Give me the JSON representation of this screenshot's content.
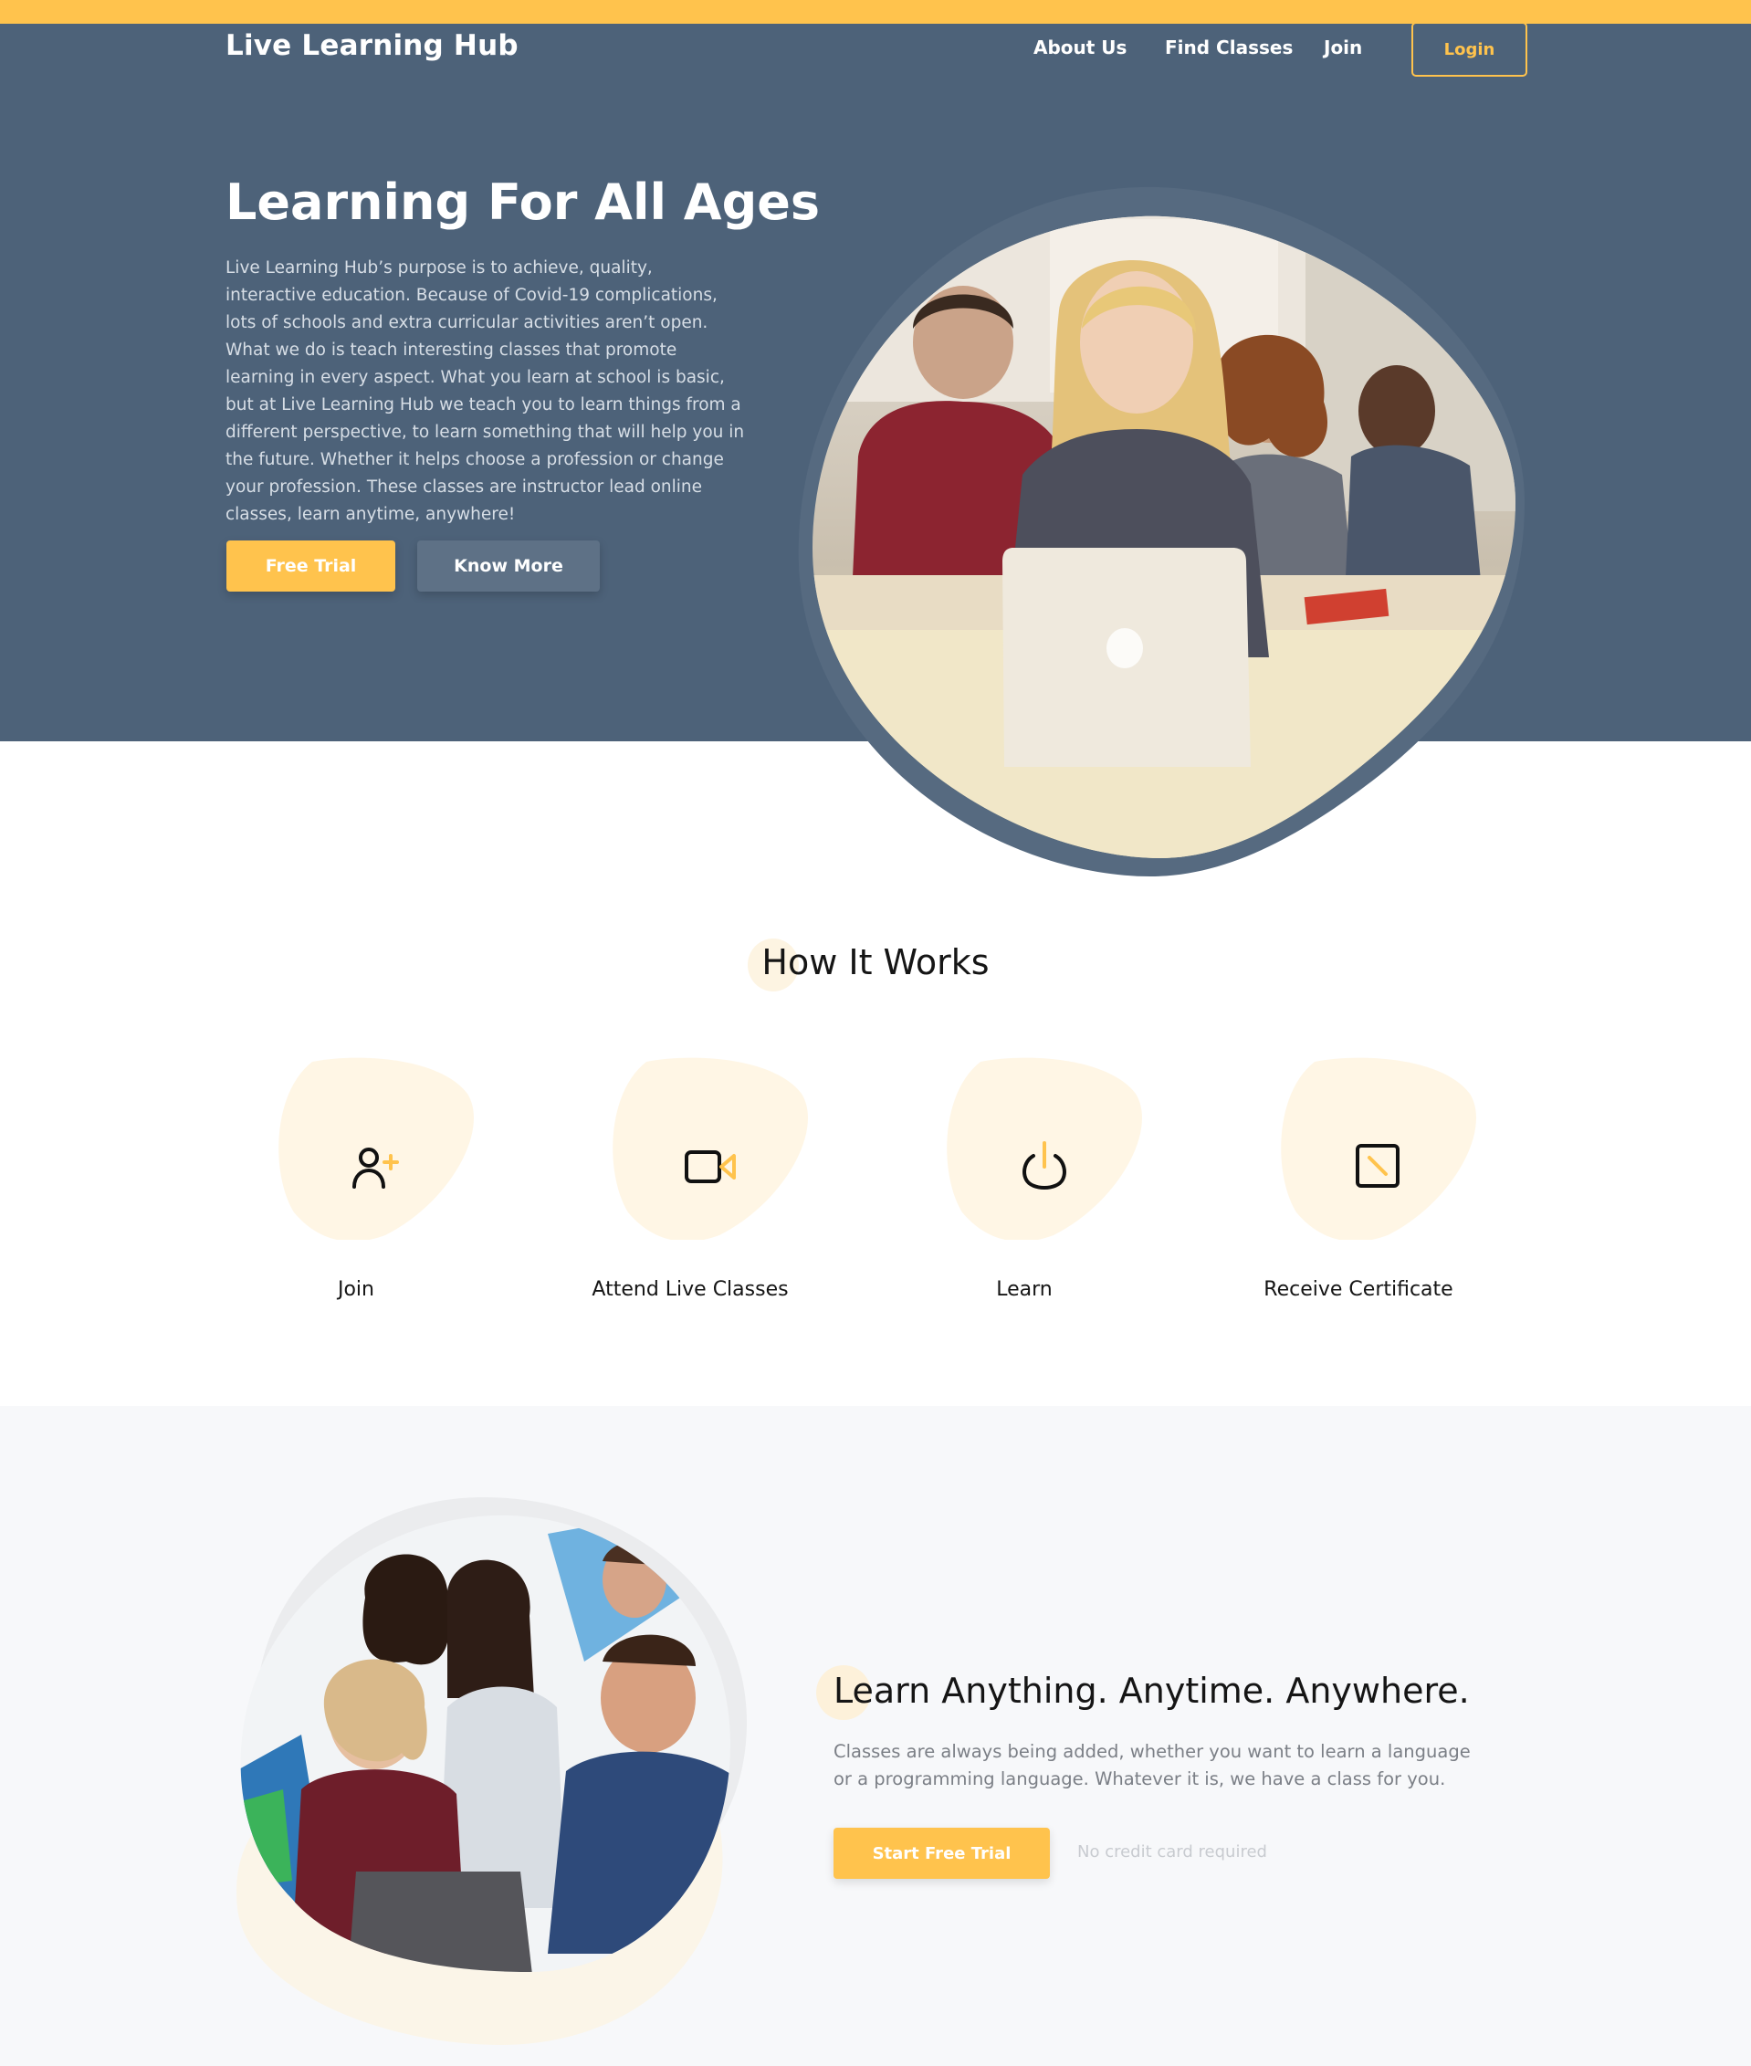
{
  "brand": {
    "name": "Live Learning Hub"
  },
  "nav": {
    "links": [
      "About Us",
      "Find Classes",
      "Join"
    ],
    "login": "Login"
  },
  "hero": {
    "title": "Learning For All Ages",
    "text": "Live Learning Hub’s purpose is to achieve, quality, interactive education. Because of Covid-19 complications, lots of schools and extra curricular activities aren’t open. What we do is teach interesting classes that promote learning in every aspect. What you learn at school is basic, but at Live Learning Hub we teach you to learn things from a different perspective, to learn something that will help you in the future. Whether it helps choose a profession or change your profession. These classes are instructor lead online classes, learn anytime, anywhere!",
    "primary_button": "Free Trial",
    "secondary_button": "Know More",
    "image": "student-with-laptop-photo"
  },
  "how_it_works": {
    "title": "How It Works",
    "steps": [
      {
        "label": "Join",
        "icon": "user-plus-icon"
      },
      {
        "label": "Attend Live Classes",
        "icon": "video-camera-icon"
      },
      {
        "label": "Learn",
        "icon": "power-icon"
      },
      {
        "label": "Receive Certificate",
        "icon": "certificate-icon"
      }
    ]
  },
  "learn_section": {
    "title": "Learn Anything. Anytime. Anywhere.",
    "text": "Classes are always being added, whether you want to learn a language or a programming language. Whatever it is, we have a class for you.",
    "button": "Start Free Trial",
    "note": "No credit card required",
    "image": "group-celebrating-at-laptop-photo"
  },
  "colors": {
    "accent": "#ffc34d",
    "hero_bg": "#4d6279",
    "secondary_button": "#5e7186",
    "section_bg": "#f7f8fa",
    "blob": "#fff6e5"
  }
}
